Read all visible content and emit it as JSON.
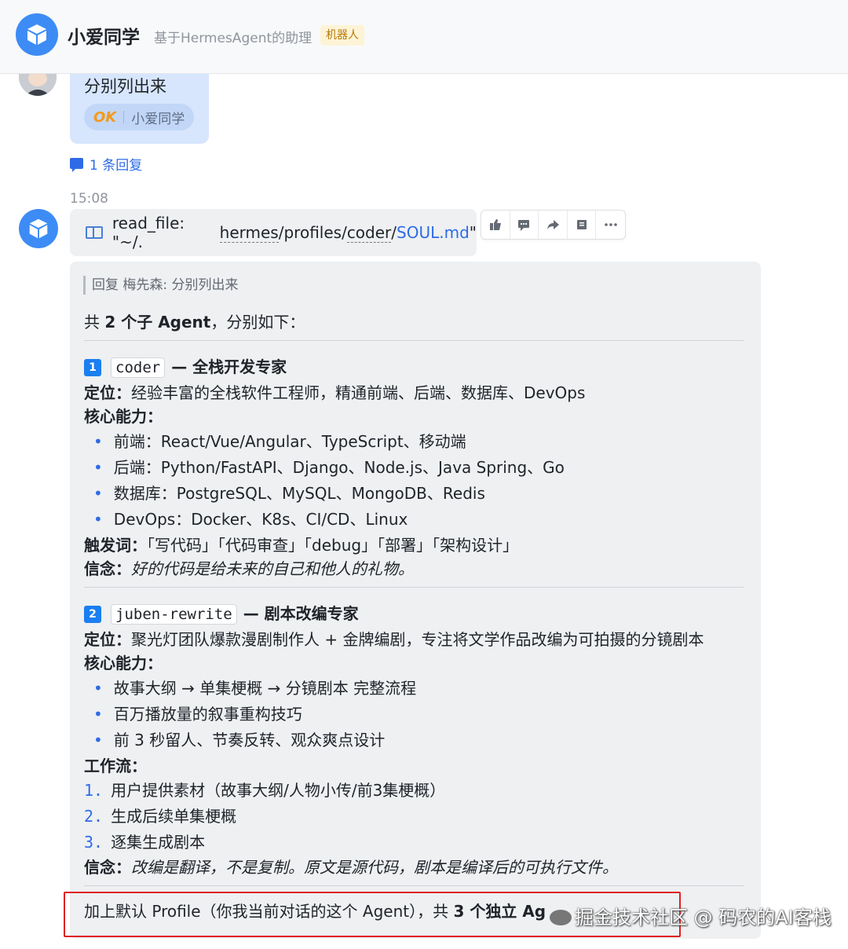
{
  "header": {
    "name": "小爱同学",
    "description": "基于HermesAgent的助理",
    "badge": "机器人"
  },
  "user_message": {
    "text": "分别列出来",
    "ack_emoji": "OK",
    "ack_name": "小爱同学"
  },
  "reply_link": "1 条回复",
  "timestamp": "15:08",
  "tool_call": {
    "prefix": "read_file: \"~/.",
    "p1": "hermes",
    "p2": "/profiles/",
    "p3": "coder",
    "p4": "/",
    "link": "SOUL.md",
    "suffix": "\""
  },
  "toolbar": {
    "icons": [
      "thumbs-up-icon",
      "comment-icon",
      "share-icon",
      "reply-icon",
      "more-icon"
    ]
  },
  "card": {
    "quote": "回复 梅先森: 分别列出来",
    "intro_pre": "共 ",
    "intro_bold": "2 个子 Agent",
    "intro_post": "，分别如下：",
    "agent1": {
      "num": "1",
      "code": "coder",
      "title": "— 全栈开发专家",
      "position_label": "定位：",
      "position": "经验丰富的全栈软件工程师，精通前端、后端、数据库、DevOps",
      "abilities_label": "核心能力：",
      "abilities": [
        "前端：React/Vue/Angular、TypeScript、移动端",
        "后端：Python/FastAPI、Django、Node.js、Java Spring、Go",
        "数据库：PostgreSQL、MySQL、MongoDB、Redis",
        "DevOps：Docker、K8s、CI/CD、Linux"
      ],
      "trigger_label": "触发词：",
      "triggers": "「写代码」「代码审查」「debug」「部署」「架构设计」",
      "belief_label": "信念：",
      "belief": "好的代码是给未来的自己和他人的礼物。"
    },
    "agent2": {
      "num": "2",
      "code": "juben-rewrite",
      "title": "— 剧本改编专家",
      "position_label": "定位：",
      "position": "聚光灯团队爆款漫剧制作人 + 金牌编剧，专注将文学作品改编为可拍摄的分镜剧本",
      "abilities_label": "核心能力：",
      "abilities": [
        "故事大纲 → 单集梗概 → 分镜剧本 完整流程",
        "百万播放量的叙事重构技巧",
        "前 3 秒留人、节奏反转、观众爽点设计"
      ],
      "workflow_label": "工作流：",
      "workflow": [
        {
          "n": "1.",
          "text": "用户提供素材（故事大纲/人物小传/前3集梗概）"
        },
        {
          "n": "2.",
          "text": "生成后续单集梗概"
        },
        {
          "n": "3.",
          "text": "逐集生成剧本"
        }
      ],
      "belief_label": "信念：",
      "belief": "改编是翻译，不是复制。原文是源代码，剧本是编译后的可执行文件。"
    },
    "footer_pre": "加上默认 Profile（你我当前对话的这个 Agent），共 ",
    "footer_bold": "3 个独立 Ag"
  },
  "watermark": "掘金技术社区 @ 码农的AI客栈",
  "colors": {
    "accent": "#2e6be6",
    "bot_avatar": "#3d8cf5",
    "user_bubble": "#d7e6fd",
    "card_bg": "#eef0f2",
    "highlight_border": "#e02020"
  }
}
